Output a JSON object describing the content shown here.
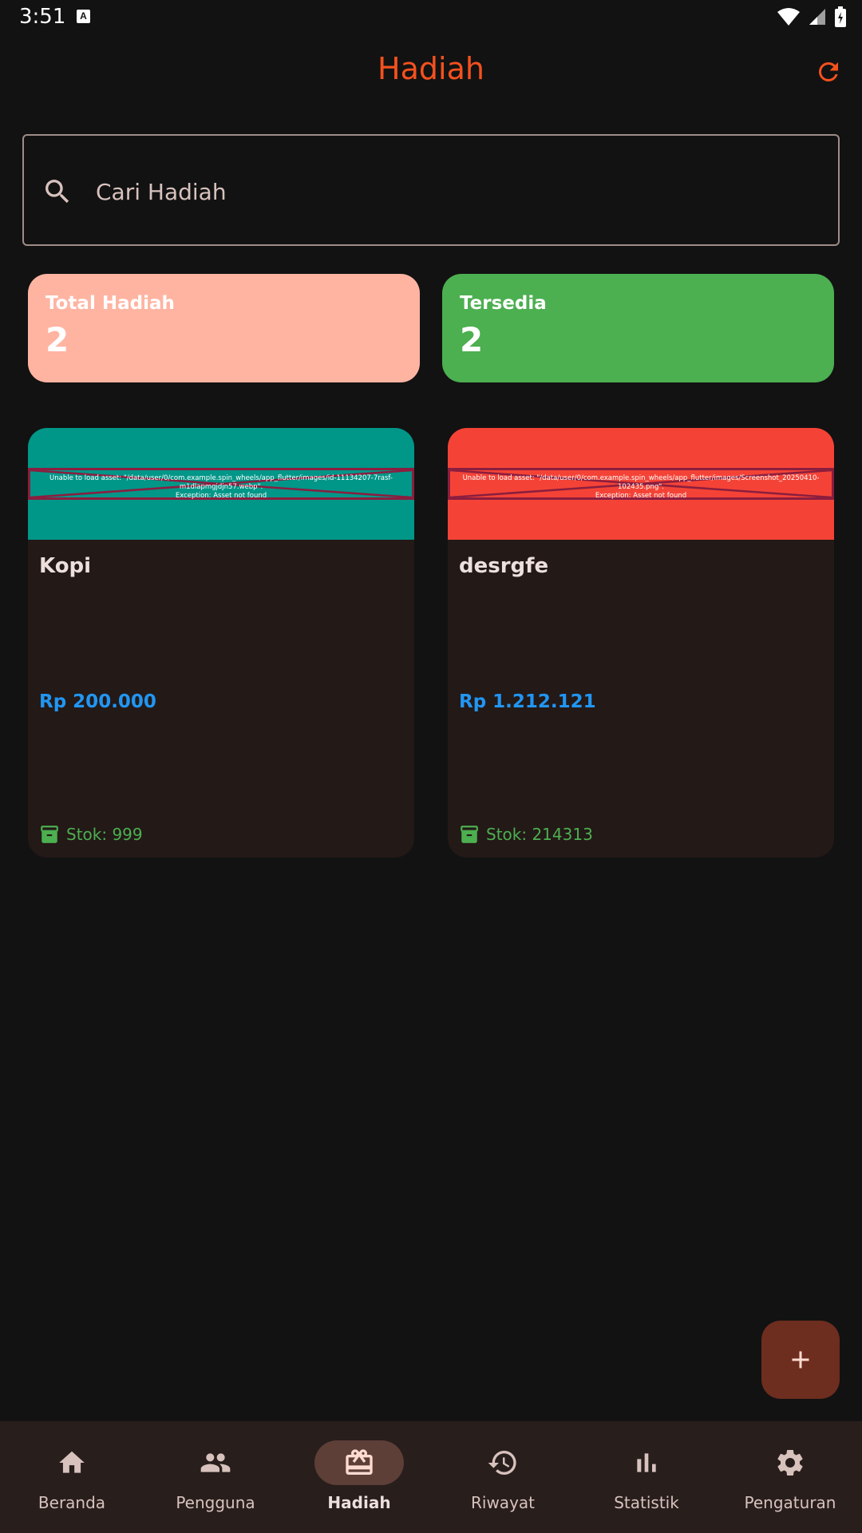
{
  "status_bar": {
    "time": "3:51",
    "notification_icon": "a-icon"
  },
  "app_bar": {
    "title": "Hadiah",
    "refresh_icon": "refresh-icon",
    "accent": "#f4511e"
  },
  "search": {
    "placeholder": "Cari Hadiah",
    "value": ""
  },
  "stats": [
    {
      "label": "Total Hadiah",
      "value": "2",
      "color": "#ffb4a2"
    },
    {
      "label": "Tersedia",
      "value": "2",
      "color": "#4caf50"
    }
  ],
  "prizes": [
    {
      "name": "Kopi",
      "price": "Rp 200.000",
      "stock": "Stok: 999",
      "banner_color": "#009688",
      "image_error": "Unable to load asset: \"/data/user/0/com.example.spin_wheels/app_flutter/images/id-11134207-7rasf-m1dlapmgjdjn57.webp\".\nException: Asset not found"
    },
    {
      "name": "desrgfe",
      "price": "Rp 1.212.121",
      "stock": "Stok: 214313",
      "banner_color": "#f44336",
      "image_error": "Unable to load asset: \"/data/user/0/com.example.spin_wheels/app_flutter/images/Screenshot_20250410-102435.png\".\nException: Asset not found"
    }
  ],
  "fab": {
    "icon": "plus-icon"
  },
  "nav": [
    {
      "label": "Beranda",
      "icon": "home-icon"
    },
    {
      "label": "Pengguna",
      "icon": "people-icon"
    },
    {
      "label": "Hadiah",
      "icon": "gift-icon",
      "active": true
    },
    {
      "label": "Riwayat",
      "icon": "history-icon"
    },
    {
      "label": "Statistik",
      "icon": "bar-chart-icon"
    },
    {
      "label": "Pengaturan",
      "icon": "gear-icon"
    }
  ]
}
